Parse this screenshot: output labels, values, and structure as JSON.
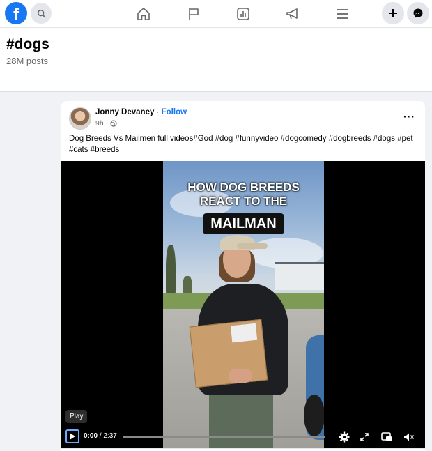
{
  "topbar": {
    "logo_letter": "f",
    "icons": [
      "search-icon",
      "home-icon",
      "flag-icon",
      "chart-icon",
      "megaphone-icon",
      "menu-icon",
      "plus-icon",
      "messenger-icon"
    ]
  },
  "page": {
    "hashtag": "#dogs",
    "post_count": "28M posts"
  },
  "post": {
    "author": "Jonny Devaney",
    "separator": "·",
    "follow_label": "Follow",
    "time": "9h ·",
    "audience_icon": "globe-icon",
    "more_label": "···",
    "caption": "Dog Breeds Vs Mailmen  full videos#God #dog #funnyvideo #dogcomedy #dogbreeds #dogs #pet #cats #breeds"
  },
  "video": {
    "overlay_title_line1": "HOW DOG BREEDS",
    "overlay_title_line2": "REACT TO THE",
    "overlay_title_highlight": "MAILMAN",
    "tooltip": "Play",
    "current_time": "0:00",
    "time_separator": " / ",
    "duration": "2:37",
    "progress": 0,
    "controls": [
      "play-icon",
      "settings-icon",
      "expand-icon",
      "picture-in-picture-icon",
      "mute-icon"
    ]
  },
  "colors": {
    "brand": "#1877f2",
    "page_bg": "#f0f2f5",
    "video_bg": "#000000"
  }
}
